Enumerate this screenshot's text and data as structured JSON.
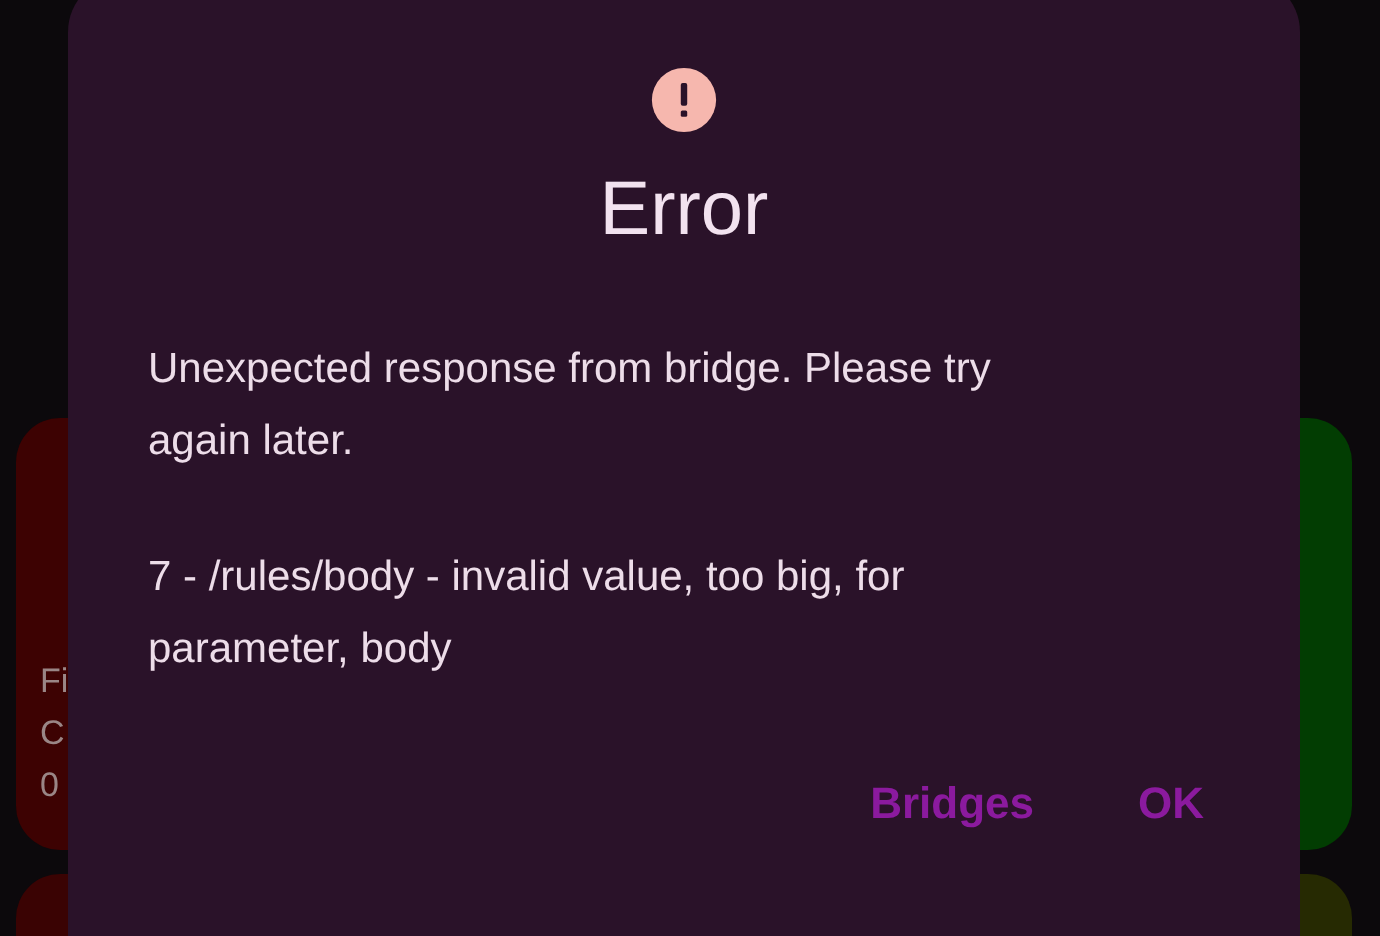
{
  "background_cards": [
    {
      "lines": [
        "Fi",
        "C",
        "0"
      ],
      "color": "#3d0202"
    },
    {
      "color": "#023d02"
    },
    {
      "color": "#3a0303"
    },
    {
      "color": "#262a02"
    }
  ],
  "dialog": {
    "title": "Error",
    "paragraphs": [
      "Unexpected response from bridge. Please try again later.",
      "7 - /rules/body - invalid value, too big, for parameter, body"
    ],
    "buttons": [
      {
        "label": "Bridges"
      },
      {
        "label": "OK"
      }
    ]
  }
}
